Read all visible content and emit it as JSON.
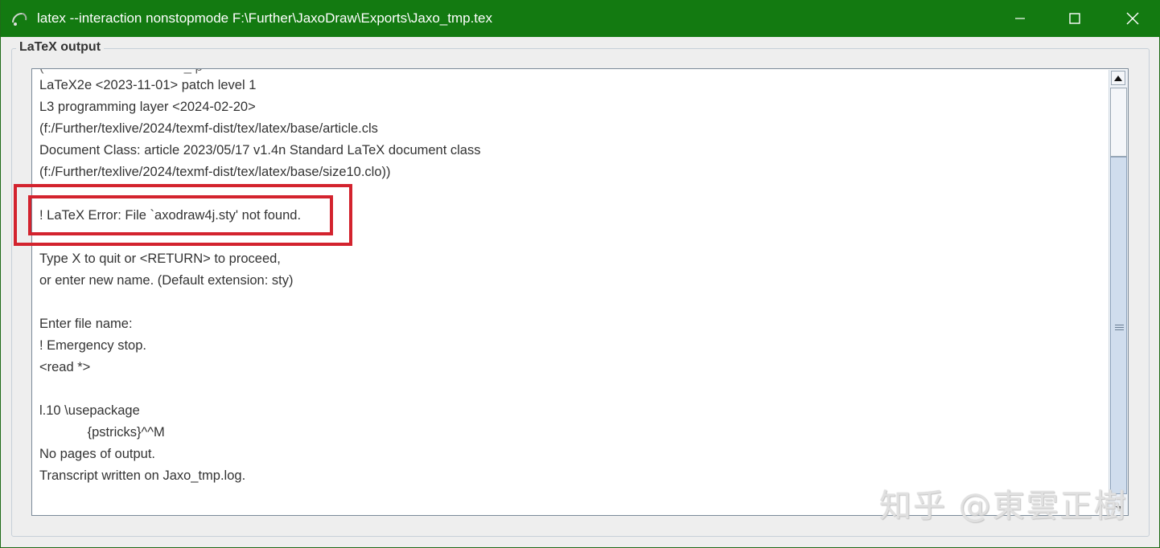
{
  "window": {
    "title": "latex --interaction nonstopmode F:\\Further\\JaxoDraw\\Exports\\Jaxo_tmp.tex",
    "accent_color": "#137a11",
    "buttons": {
      "minimize_icon": "minimize-icon",
      "maximize_icon": "maximize-icon",
      "close_icon": "close-icon"
    }
  },
  "panel": {
    "title": "LaTeX output"
  },
  "output": {
    "lines": [
      "LaTeX2e <2023-11-01> patch level 1",
      "L3 programming layer <2024-02-20>",
      "(f:/Further/texlive/2024/texmf-dist/tex/latex/base/article.cls",
      "Document Class: article 2023/05/17 v1.4n Standard LaTeX document class",
      "(f:/Further/texlive/2024/texmf-dist/tex/latex/base/size10.clo))",
      "",
      "! LaTeX Error: File `axodraw4j.sty' not found.",
      "",
      "Type X to quit or <RETURN> to proceed,",
      "or enter new name. (Default extension: sty)",
      "",
      "Enter file name:",
      "! Emergency stop.",
      "<read *>",
      "",
      "l.10 \\usepackage",
      "             {pstricks}^^M",
      "No pages of output.",
      "Transcript written on Jaxo_tmp.log."
    ],
    "highlight_color": "#d3232e"
  },
  "watermark": {
    "text": "知乎 @東雲正樹"
  }
}
